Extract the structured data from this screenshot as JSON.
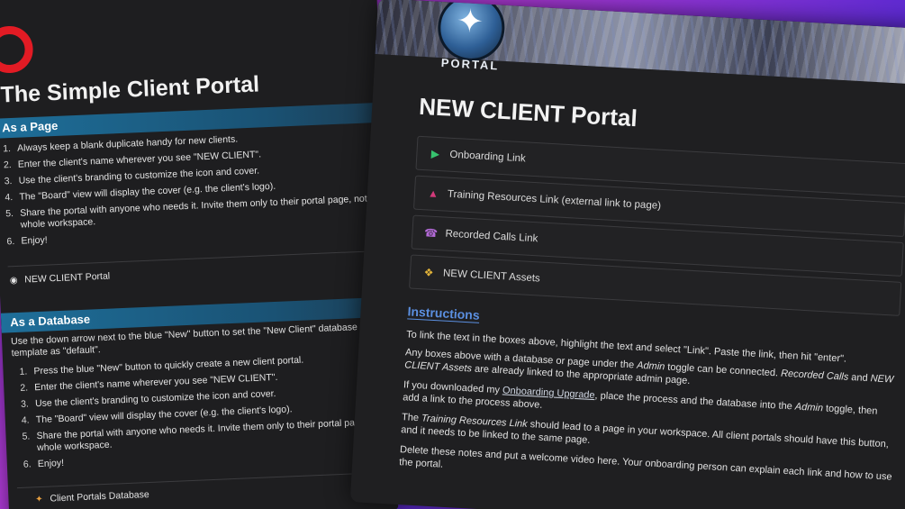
{
  "left_panel": {
    "title": "The Simple Client Portal",
    "page_section": {
      "heading": "As a Page",
      "steps": [
        {
          "num": "1.",
          "text": "Always keep a blank duplicate handy for new clients."
        },
        {
          "num": "2.",
          "text": "Enter the client's name wherever you see \"NEW CLIENT\"."
        },
        {
          "num": "3.",
          "text": "Use the client's branding to customize the icon and cover."
        },
        {
          "num": "4.",
          "text": "The \"Board\" view will display the cover (e.g. the client's logo)."
        },
        {
          "num": "5.",
          "text": "Share the portal with anyone who needs it. Invite them only to their portal page, not the whole workspace."
        },
        {
          "num": "6.",
          "text": "Enjoy!"
        }
      ],
      "page_link": "NEW CLIENT Portal"
    },
    "database_section": {
      "heading": "As a Database",
      "intro": "Use the down arrow next to the blue \"New\" button to set the \"New Client\" database template as \"default\".",
      "steps": [
        {
          "num": "1.",
          "text": "Press the blue \"New\" button to quickly create a new client portal."
        },
        {
          "num": "2.",
          "text": "Enter the client's name wherever you see \"NEW CLIENT\"."
        },
        {
          "num": "3.",
          "text": "Use the client's branding to customize the icon and cover."
        },
        {
          "num": "4.",
          "text": "The \"Board\" view will display the cover (e.g. the client's logo)."
        },
        {
          "num": "5.",
          "text": "Share the portal with anyone who needs it. Invite them only to their portal page, not the whole workspace."
        },
        {
          "num": "6.",
          "text": "Enjoy!"
        }
      ],
      "db_link": "Client Portals Database"
    }
  },
  "right_panel": {
    "logo_text": "PORTAL",
    "title": "NEW CLIENT Portal",
    "links": [
      {
        "label": "Onboarding Link",
        "icon": "play-icon"
      },
      {
        "label": "Training Resources Link (external link to page)",
        "icon": "graduation-cap-icon"
      },
      {
        "label": "Recorded Calls Link",
        "icon": "telephone-icon"
      },
      {
        "label": "NEW CLIENT Assets",
        "icon": "palette-icon"
      }
    ],
    "instructions": {
      "heading": "Instructions",
      "p1": "To link the text in the boxes above, highlight the text and select \"Link\". Paste the link, then hit \"enter\".",
      "p2_a": "Any boxes above with a database or page under the ",
      "p2_admin": "Admin",
      "p2_b": " toggle can be connected. ",
      "p2_rc": "Recorded Calls",
      "p2_and": " and ",
      "p2_nca": "NEW CLIENT Assets",
      "p2_c": " are already linked to the appropriate admin page.",
      "p3_a": "If you downloaded my ",
      "p3_link": "Onboarding Upgrade",
      "p3_b": ", place the process and the database into the ",
      "p3_admin": "Admin",
      "p3_c": " toggle, then add a link to the process above.",
      "p4_a": "The ",
      "p4_trl": "Training Resources Link",
      "p4_b": " should lead to a page in your workspace. All client portals should have this button, and it needs to be linked to the same page.",
      "p5": "Delete these notes and put a welcome video here. Your onboarding person can explain each link and how to use the portal."
    }
  },
  "colors": {
    "ring": "#e21b24",
    "section_head": "#1e6f9a",
    "instructions_heading": "#5b8fe0",
    "play_icon": "#37c26e"
  }
}
